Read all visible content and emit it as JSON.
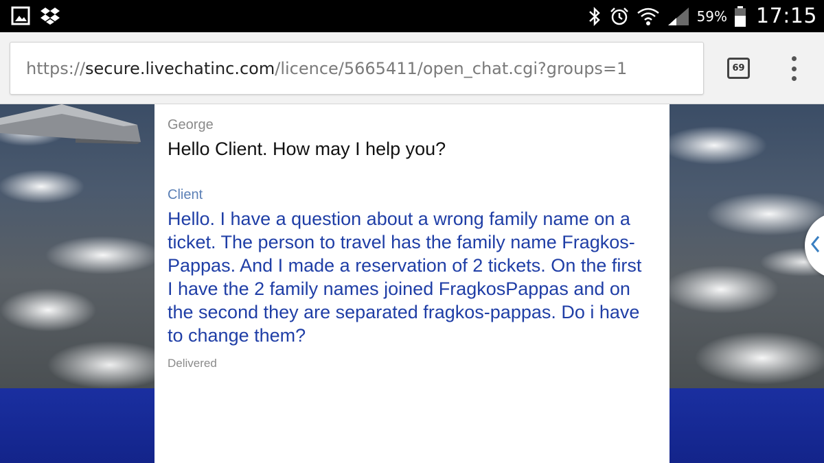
{
  "status_bar": {
    "left_icons": [
      "gallery-icon",
      "dropbox-icon"
    ],
    "right_icons": [
      "bluetooth-icon",
      "alarm-icon",
      "wifi-icon",
      "signal-icon",
      "battery-icon"
    ],
    "battery_percent": "59%",
    "time": "17:15"
  },
  "browser": {
    "url_scheme": "https://",
    "url_host": "secure.livechatinc.com",
    "url_path": "/licence/5665411/open_chat.cgi?groups=1",
    "tab_count": "69"
  },
  "chat": {
    "messages": [
      {
        "author": "George",
        "text": "Hello Client. How may I help you?"
      },
      {
        "author": "Client",
        "text": "Hello. I have a question about a wrong family name on a ticket. The person to travel has the family name Fragkos-Pappas. And I made a reservation of 2 tickets. On the first I have the 2 family names joined FragkosPappas and on the second they are separated fragkos-pappas. Do i have to change them?",
        "status": "Delivered"
      }
    ]
  },
  "colors": {
    "client_text": "#1f3ea6",
    "footer_band": "#1a2fa0"
  }
}
